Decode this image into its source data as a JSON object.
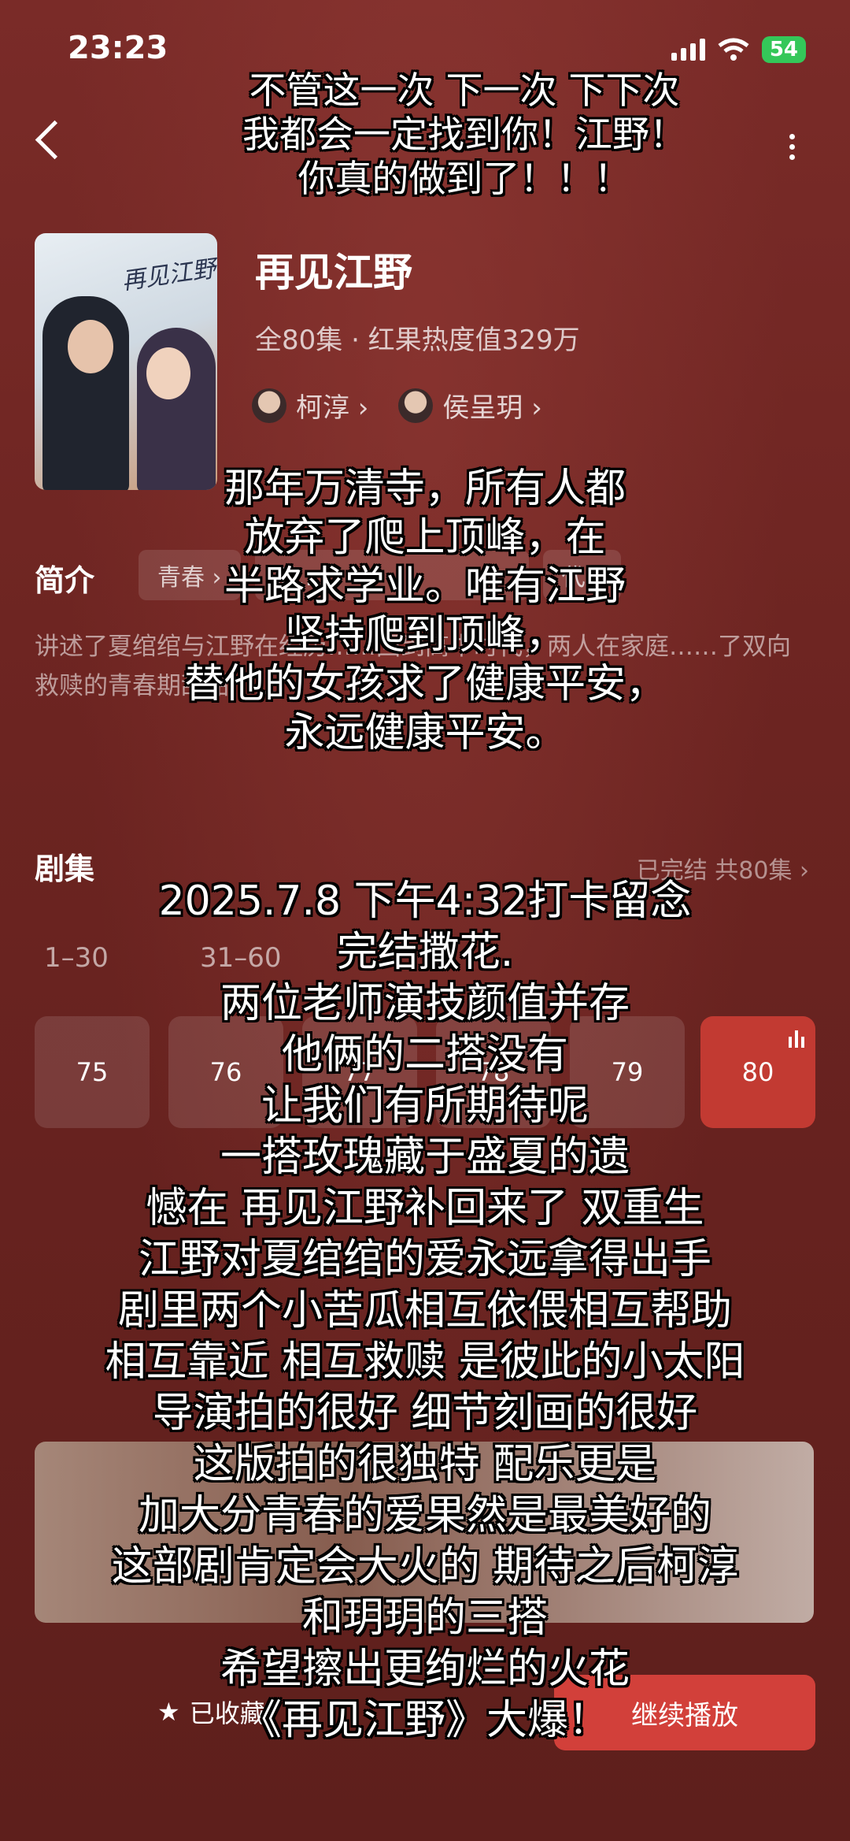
{
  "status": {
    "time": "23:23",
    "battery": "54"
  },
  "drama": {
    "title": "再见江野",
    "meta": "全80集 · 红果热度值329万",
    "actors": [
      "柯淳 ›",
      "侯呈玥 ›"
    ],
    "poster_title": "再见江野"
  },
  "intro": {
    "label": "简介",
    "tags": [
      "青春 ›",
      "双…",
      "代 ›"
    ],
    "text": "讲述了夏绾绾与江野在经历……回到高中时代，两人在家庭……了双向救赎的青春期甜甜……"
  },
  "episodes": {
    "label": "剧集",
    "status": "已完结 共80集 ›",
    "ranges": [
      "1–30",
      "31–60"
    ],
    "items": [
      {
        "label": "75",
        "active": false
      },
      {
        "label": "76",
        "active": false
      },
      {
        "label": "77",
        "active": false
      },
      {
        "label": "78",
        "active": false
      },
      {
        "label": "79",
        "active": false
      },
      {
        "label": "80",
        "active": true
      }
    ]
  },
  "bottom_bar": {
    "favorite": "已收藏",
    "play": "继续播放"
  },
  "captions": {
    "top": "不管这一次 下一次 下下次\n我都会一定找到你！江野！\n你真的做到了！！！",
    "middle": "那年万清寺，所有人都\n放弃了爬上顶峰，在\n半路求学业。唯有江野\n坚持爬到顶峰，\n替他的女孩求了健康平安，\n永远健康平安。",
    "main": "2025.7.8 下午4:32打卡留念\n完结撒花.\n两位老师演技颜值并存\n他俩的二搭没有\n让我们有所期待呢\n一搭玫瑰藏于盛夏的遗\n憾在 再见江野补回来了 双重生\n江野对夏绾绾的爱永远拿得出手\n剧里两个小苦瓜相互依偎相互帮助\n相互靠近 相互救赎 是彼此的小太阳\n导演拍的很好 细节刻画的很好\n这版拍的很独特 配乐更是\n加大分青春的爱果然是最美好的\n这部剧肯定会大火的 期待之后柯淳\n和玥玥的三搭\n希望擦出更绚烂的火花\n《再见江野》大爆！"
  }
}
